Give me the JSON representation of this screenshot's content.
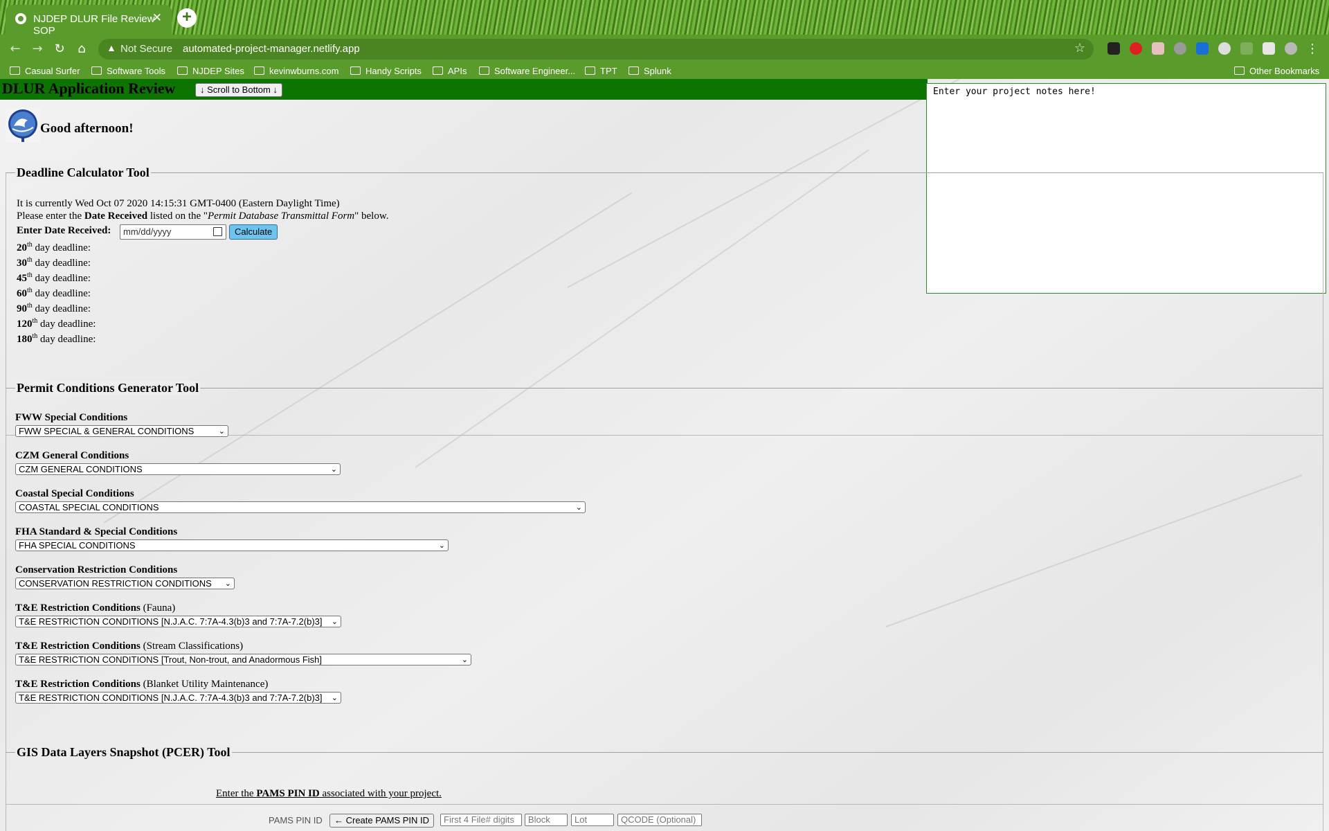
{
  "browser": {
    "tab_title": "NJDEP DLUR File Review SOP",
    "tab_close": "✕",
    "new_tab": "+",
    "security_label": "Not Secure",
    "url": "automated-project-manager.netlify.app",
    "bookmarks": [
      "Casual Surfer",
      "Software Tools",
      "NJDEP Sites",
      "kevinwburns.com",
      "Handy Scripts",
      "APIs",
      "Software Engineer...",
      "TPT",
      "Splunk"
    ],
    "other_bookmarks": "Other Bookmarks",
    "nav": {
      "back": "←",
      "forward": "→",
      "reload": "↻",
      "home": "⌂",
      "star": "☆",
      "menu": "⋮"
    }
  },
  "header": {
    "title": "DLUR Application Review",
    "scroll_button": "↓ Scroll to Bottom ↓"
  },
  "notes": {
    "text": "Enter your project notes here!"
  },
  "greeting": "Good afternoon!",
  "deadline_tool": {
    "legend": "Deadline Calculator Tool",
    "current_time": "It is currently Wed Oct 07 2020 14:15:31 GMT-0400 (Eastern Daylight Time)",
    "instruction_prefix": "Please enter the ",
    "instruction_bold": "Date Received",
    "instruction_mid": " listed on the \"",
    "instruction_italic": "Permit Database Transmittal Form",
    "instruction_suffix": "\" below.",
    "date_label": "Enter Date Received:",
    "date_placeholder": "mm/dd/yyyy",
    "calculate_button": "Calculate",
    "th": "th",
    "deadline_suffix": " day deadline:",
    "deadlines": [
      "20",
      "30",
      "45",
      "60",
      "90",
      "120",
      "180"
    ]
  },
  "conditions_tool": {
    "legend": "Permit Conditions Generator Tool",
    "groups": [
      {
        "label_bold": "FWW Special Conditions",
        "label_normal": "",
        "selected": "FWW SPECIAL & GENERAL CONDITIONS"
      },
      {
        "label_bold": "CZM General Conditions",
        "label_normal": "",
        "selected": "CZM GENERAL CONDITIONS"
      },
      {
        "label_bold": "Coastal Special Conditions",
        "label_normal": "",
        "selected": "COASTAL SPECIAL CONDITIONS"
      },
      {
        "label_bold": "FHA Standard & Special Conditions",
        "label_normal": "",
        "selected": "FHA SPECIAL CONDITIONS"
      },
      {
        "label_bold": "Conservation Restriction Conditions",
        "label_normal": "",
        "selected": "CONSERVATION RESTRICTION CONDITIONS"
      },
      {
        "label_bold": "T&E Restriction Conditions",
        "label_normal": " (Fauna)",
        "selected": "T&E RESTRICTION CONDITIONS [N.J.A.C. 7:7A-4.3(b)3 and 7:7A-7.2(b)3]"
      },
      {
        "label_bold": "T&E Restriction Conditions",
        "label_normal": " (Stream Classifications)",
        "selected": "T&E RESTRICTION CONDITIONS [Trout, Non-trout, and Anadormous Fish]"
      },
      {
        "label_bold": "T&E Restriction Conditions",
        "label_normal": " (Blanket Utility Maintenance)",
        "selected": "T&E RESTRICTION CONDITIONS [N.J.A.C. 7:7A-4.3(b)3 and 7:7A-7.2(b)3]"
      }
    ]
  },
  "gis_tool": {
    "legend": "GIS Data Layers Snapshot (PCER) Tool",
    "instruction_prefix": "Enter the ",
    "instruction_bold": "PAMS PIN ID",
    "instruction_suffix": " associated with your project.",
    "pin_label": "PAMS PIN ID",
    "create_button": "← Create PAMS PIN ID",
    "placeholders": [
      "First 4 File# digits",
      "Block",
      "Lot",
      "QCODE (Optional)"
    ]
  },
  "colors": {
    "header_green": "#0b7500",
    "chrome_green": "#5a9c2c",
    "calculate_blue": "#6cc4f0"
  }
}
